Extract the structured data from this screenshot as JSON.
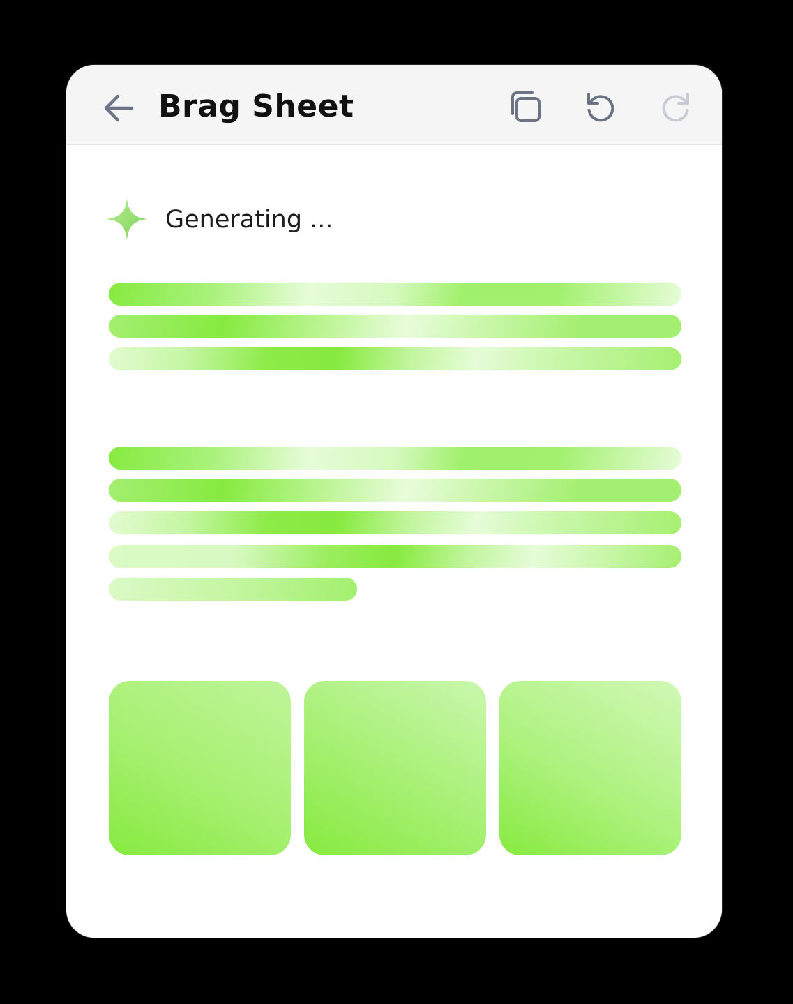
{
  "header": {
    "title": "Brag Sheet",
    "back_icon": "arrow-left-icon",
    "copy_icon": "copy-icon",
    "undo_icon": "undo-icon",
    "redo_icon": "redo-icon"
  },
  "status": {
    "icon": "sparkle-icon",
    "text": "Generating ..."
  },
  "colors": {
    "background": "#000000",
    "card": "#ffffff",
    "header": "#f5f5f6",
    "accent_green": "#86ea3f",
    "light_green": "#e6fcd8",
    "sparkle_green": "#8fdc6a",
    "icon_gray": "#6b7385",
    "icon_disabled": "#c7ccd4"
  }
}
